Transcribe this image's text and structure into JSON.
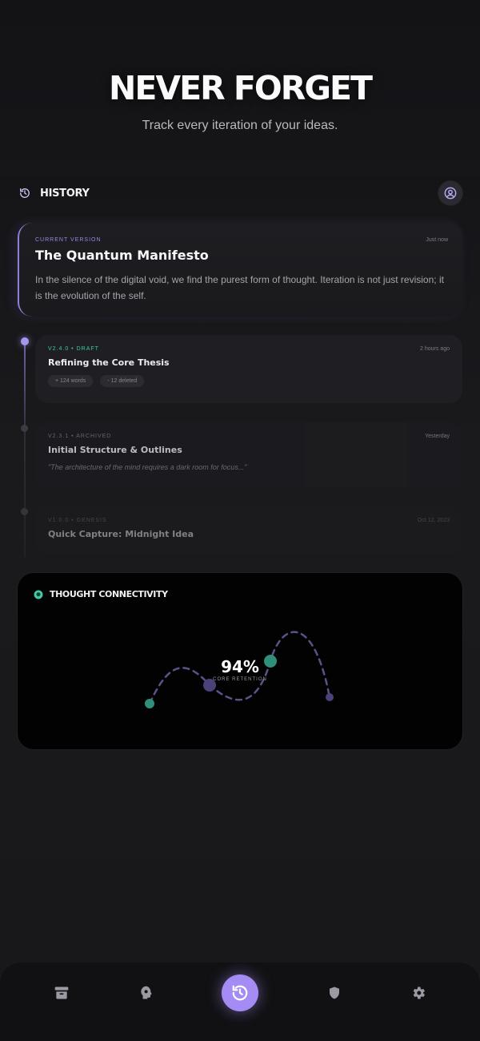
{
  "hero": {
    "title": "NEVER FORGET",
    "subtitle": "Track every iteration of your ideas."
  },
  "history": {
    "title": "HISTORY",
    "icon": "history-icon",
    "profile_icon": "user-circle-icon"
  },
  "current_version": {
    "tag": "CURRENT VERSION",
    "time": "Just now",
    "title": "The Quantum Manifesto",
    "body": "In the silence of the digital void, we find the purest form of thought. Iteration is not just revision; it is the evolution of the self."
  },
  "versions": [
    {
      "tag": "V2.4.0 • DRAFT",
      "time": "2 hours ago",
      "title": "Refining the Core Thesis",
      "chips": [
        "+ 124 words",
        "- 12 deleted"
      ]
    },
    {
      "tag": "V2.3.1 • ARCHIVED",
      "time": "Yesterday",
      "title": "Initial Structure & Outlines",
      "quote": "\"The architecture of the mind requires a dark room for focus...\""
    },
    {
      "tag": "V1.0.0 • GENESIS",
      "time": "Oct 12, 2023",
      "title": "Quick Capture: Midnight Idea"
    }
  ],
  "connectivity": {
    "title": "THOUGHT CONNECTIVITY",
    "icon": "brain-icon",
    "value": "94%",
    "label": "CORE RETENTION"
  },
  "nav": {
    "items": [
      "archive-icon",
      "brain-icon",
      "history-icon",
      "shield-icon",
      "gear-icon"
    ],
    "active": "history-icon"
  },
  "colors": {
    "accent": "#a58cf5",
    "teal": "#3fc7a6",
    "background": "#161618"
  }
}
